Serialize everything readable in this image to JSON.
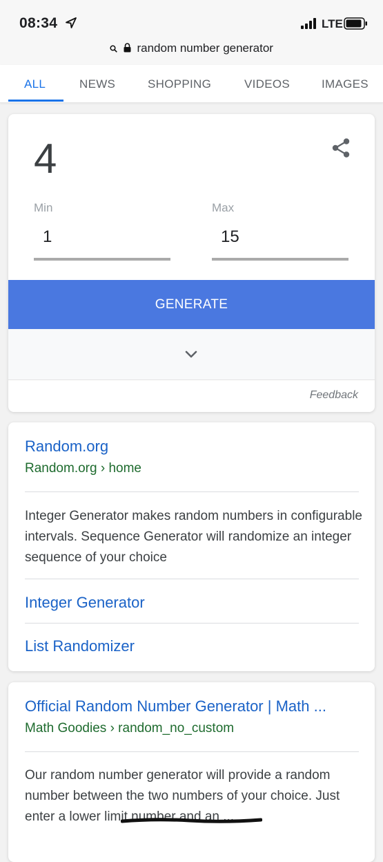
{
  "status_bar": {
    "time": "08:34",
    "network": "LTE"
  },
  "url_bar": {
    "text": "random number generator"
  },
  "tabs": [
    {
      "label": "ALL",
      "active": true
    },
    {
      "label": "NEWS"
    },
    {
      "label": "SHOPPING"
    },
    {
      "label": "VIDEOS"
    },
    {
      "label": "IMAGES"
    }
  ],
  "rng": {
    "result": "4",
    "min_label": "Min",
    "min_value": "1",
    "max_label": "Max",
    "max_value": "15",
    "generate_label": "GENERATE",
    "feedback_label": "Feedback"
  },
  "results": [
    {
      "title": "Random.org",
      "url": "Random.org › home",
      "snippet": "Integer Generator makes random numbers in configurable intervals. Sequence Generator will randomize an integer sequence of your choice",
      "sitelinks": [
        "Integer Generator",
        "List Randomizer"
      ]
    },
    {
      "title": "Official Random Number Generator | Math ...",
      "url": "Math Goodies › random_no_custom",
      "snippet": "Our random number generator will provide a random number between the two numbers of your choice. Just enter a lower limit number and an ..."
    }
  ],
  "colors": {
    "accent": "#1a73e8",
    "generate_button": "#4a78e0",
    "link": "#1a62c7",
    "url_green": "#1e6b2e"
  },
  "icons": [
    "location-arrow-icon",
    "signal-bars-icon",
    "battery-icon",
    "search-icon",
    "lock-icon",
    "share-icon",
    "chevron-down-icon"
  ]
}
